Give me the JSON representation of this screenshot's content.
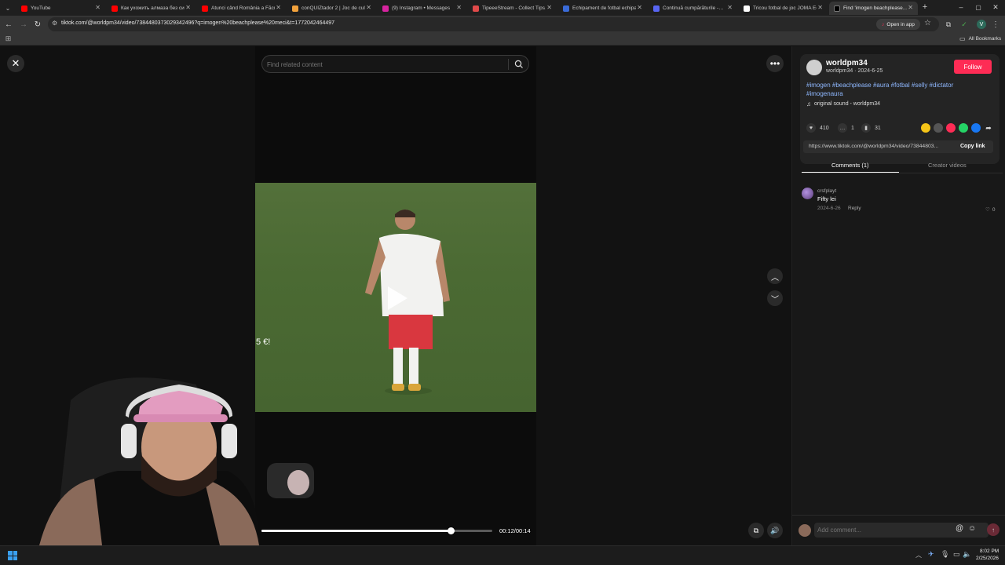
{
  "browser": {
    "tabs": [
      {
        "title": "YouTube",
        "color": "#ff0000",
        "active": false
      },
      {
        "title": "Как ухожить алмаза без си…",
        "color": "#ff0000",
        "active": false
      },
      {
        "title": "Atunci când România a Făcut…",
        "color": "#ff0000",
        "active": false
      },
      {
        "title": "conQUIZtador 2 | Joc de cultură…",
        "color": "#f2a23c",
        "active": false
      },
      {
        "title": "(9) Instagram • Messages",
        "color": "#d6249f",
        "active": false
      },
      {
        "title": "TipeeeStream - Collect Tips…",
        "color": "#e04a4a",
        "active": false
      },
      {
        "title": "Echipament de fotbal echipa…",
        "color": "#3a6bd8",
        "active": false
      },
      {
        "title": "Continuă cumpărăturile -…",
        "color": "#5865f2",
        "active": false
      },
      {
        "title": "Tricou fotbal de joc JOMA Echi…",
        "color": "#ffffff",
        "active": false
      },
      {
        "title": "Find 'imogen beachplease…",
        "color": "#000000",
        "active": true
      }
    ],
    "url": "tiktok.com/@worldpm34/video/7384480373029342496?q=imogen%20beachplease%20meci&t=1772042464497",
    "open_in_app_label": "Open in app",
    "all_bookmarks_label": "All Bookmarks"
  },
  "video": {
    "search_placeholder": "Find related content",
    "elapsed": "00:12",
    "duration": "00:14",
    "time_display": "00:12/00:14",
    "progress": 0.82,
    "overlay_text": "5 €!"
  },
  "post": {
    "username": "worldpm34",
    "handle_date": "worldpm34 · 2024-6-25",
    "follow_label": "Follow",
    "hashtags": "#imogen #beachplease #aura #fotbal #selly #dictator #imogenaura",
    "sound": "original sound - worldpm34",
    "likes": "410",
    "comments_count": "1",
    "saves": "31",
    "link": "https://www.tiktok.com/@worldpm34/video/73844803...",
    "copy_link_label": "Copy link",
    "tab_comments": "Comments (1)",
    "tab_creator": "Creator videos",
    "share_colors": [
      "#f5c518",
      "#555555",
      "#fe2c55",
      "#25d366",
      "#1877f2"
    ]
  },
  "comment": {
    "author": "crsfplayt",
    "text": "Fifty lei",
    "date": "2024-6-26",
    "reply_label": "Reply",
    "likes": "0"
  },
  "comment_input": {
    "placeholder": "Add comment..."
  },
  "taskbar": {
    "time": "8:02 PM",
    "date": "2/25/2026"
  },
  "colors": {
    "accent": "#fe2c55",
    "link": "#8fb8ff"
  }
}
